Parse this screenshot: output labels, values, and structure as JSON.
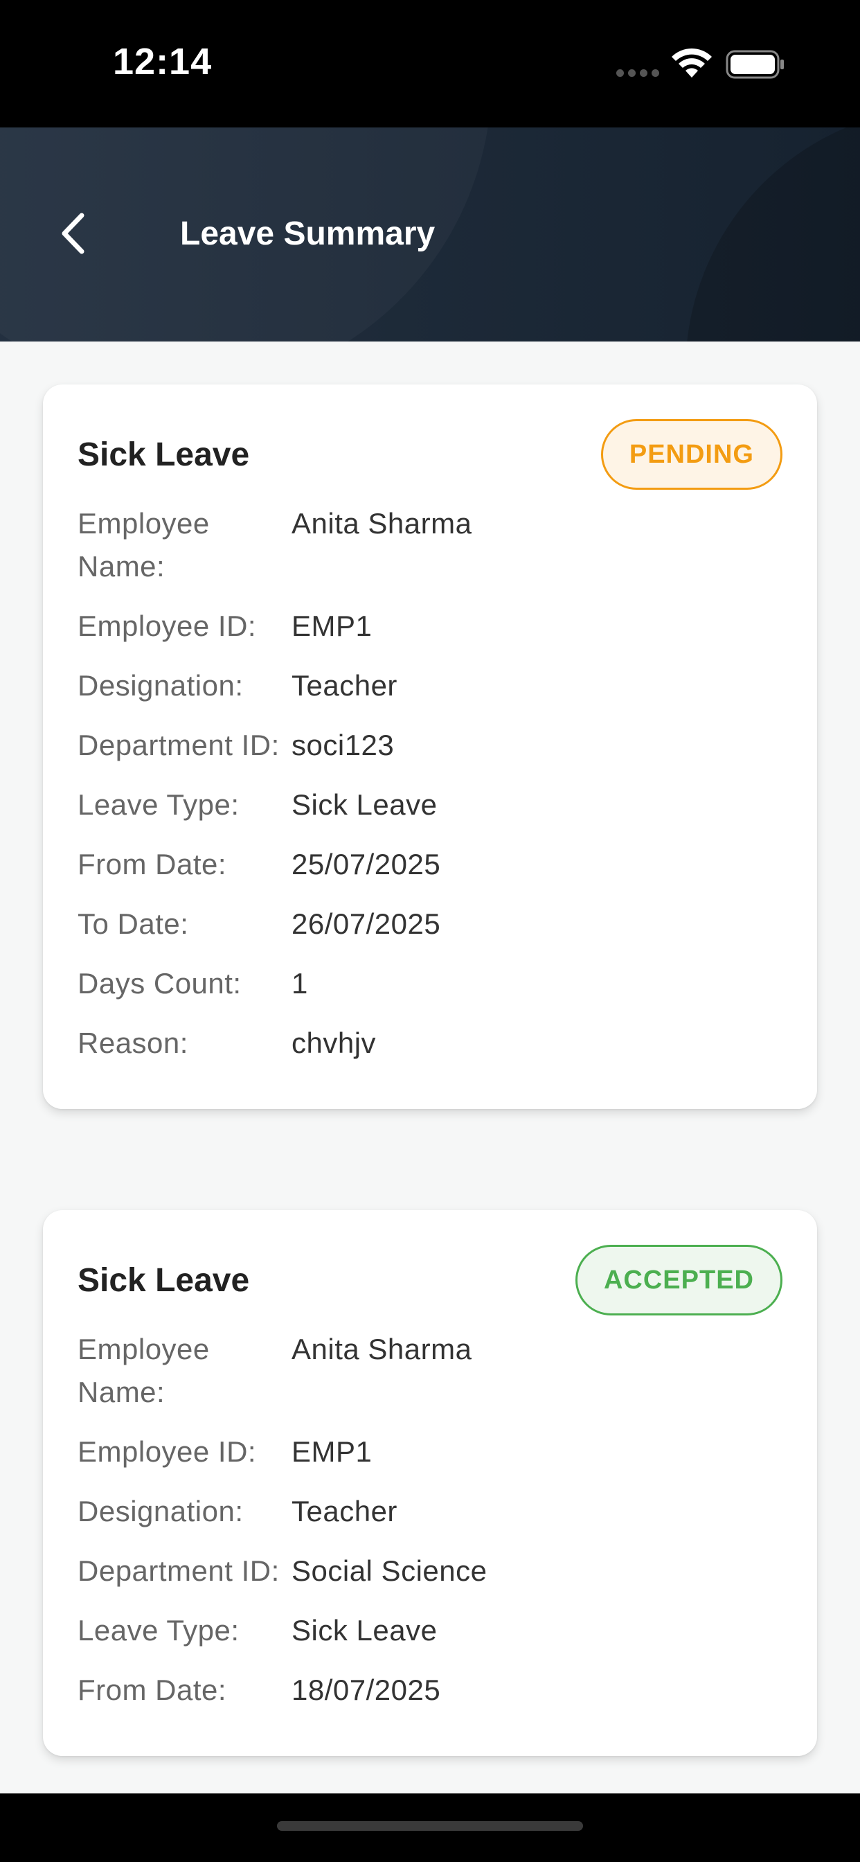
{
  "status_bar": {
    "time": "12:14"
  },
  "header": {
    "title": "Leave Summary"
  },
  "leaves": [
    {
      "title": "Sick Leave",
      "status": "PENDING",
      "fields": [
        {
          "label": "Employee Name:",
          "value": "Anita Sharma"
        },
        {
          "label": "Employee ID:",
          "value": "EMP1"
        },
        {
          "label": "Designation:",
          "value": "Teacher"
        },
        {
          "label": "Department ID:",
          "value": "soci123"
        },
        {
          "label": "Leave Type:",
          "value": "Sick Leave"
        },
        {
          "label": "From Date:",
          "value": "25/07/2025"
        },
        {
          "label": "To Date:",
          "value": "26/07/2025"
        },
        {
          "label": "Days Count:",
          "value": "1"
        },
        {
          "label": "Reason:",
          "value": "chvhjv"
        }
      ]
    },
    {
      "title": "Sick Leave",
      "status": "ACCEPTED",
      "fields": [
        {
          "label": "Employee Name:",
          "value": "Anita Sharma"
        },
        {
          "label": "Employee ID:",
          "value": "EMP1"
        },
        {
          "label": "Designation:",
          "value": "Teacher"
        },
        {
          "label": "Department ID:",
          "value": "Social Science"
        },
        {
          "label": "Leave Type:",
          "value": "Sick Leave"
        },
        {
          "label": "From Date:",
          "value": "18/07/2025"
        }
      ]
    }
  ],
  "colors": {
    "header_bg": "#1a2838",
    "pending": "#f39c12",
    "accepted": "#4caf50"
  },
  "icons": {
    "back": "chevron-left-icon",
    "wifi": "wifi-icon",
    "battery": "battery-icon",
    "signal": "cellular-signal-icon"
  }
}
